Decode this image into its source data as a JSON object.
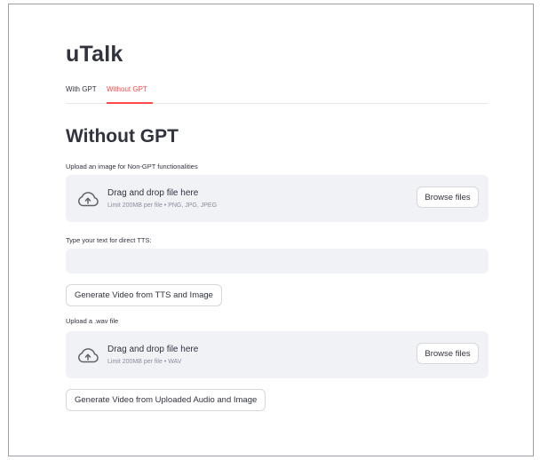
{
  "app": {
    "title": "uTalk"
  },
  "tabs": [
    {
      "label": "With GPT",
      "active": false
    },
    {
      "label": "Without GPT",
      "active": true
    }
  ],
  "section": {
    "heading": "Without GPT"
  },
  "image_upload": {
    "label": "Upload an image for Non-GPT functionalities",
    "dropzone_title": "Drag and drop file here",
    "dropzone_limit": "Limit 200MB per file • PNG, JPG, JPEG",
    "browse_label": "Browse files",
    "icon": "cloud-upload-icon"
  },
  "tts_input": {
    "label": "Type your text for direct TTS:",
    "value": "",
    "placeholder": ""
  },
  "generate_tts_button": {
    "label": "Generate Video from TTS and Image"
  },
  "audio_upload": {
    "label": "Upload a .wav file",
    "dropzone_title": "Drag and drop file here",
    "dropzone_limit": "Limit 200MB per file • WAV",
    "browse_label": "Browse files",
    "icon": "cloud-upload-icon"
  },
  "generate_audio_button": {
    "label": "Generate Video from Uploaded Audio and Image"
  },
  "colors": {
    "accent": "#ff4b4b",
    "text": "#31333f",
    "muted": "#8a8e99",
    "surface": "#f0f2f6"
  }
}
